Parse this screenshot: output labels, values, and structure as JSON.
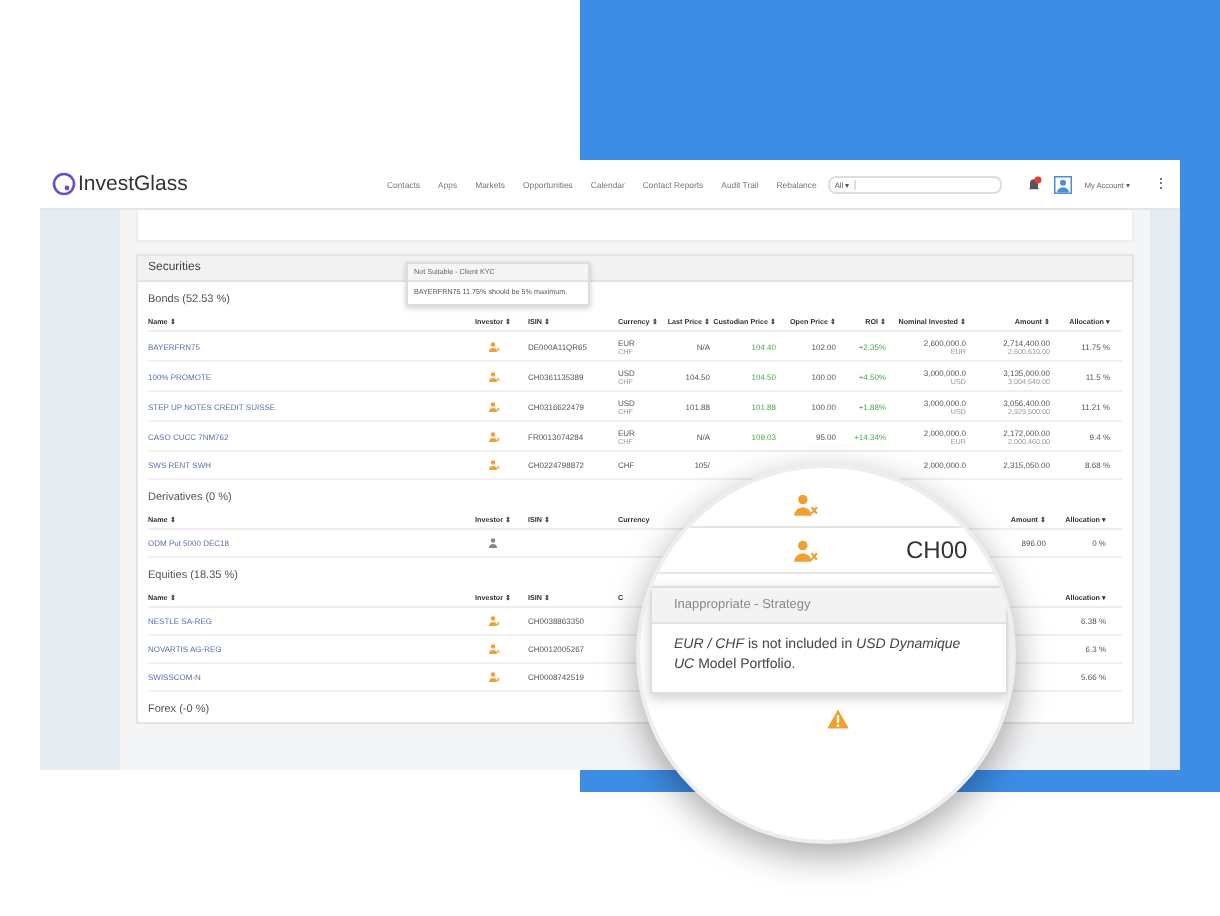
{
  "nav": {
    "logo": "InvestGlass",
    "links": [
      "Contacts",
      "Apps",
      "Markets",
      "Opportunities",
      "Calendar",
      "Contact Reports",
      "Audit Trail",
      "Rebalance"
    ],
    "search_scope": "All ▾",
    "user": "My Account ▾",
    "more": "⋮"
  },
  "securities": {
    "title": "Securities"
  },
  "sections": [
    {
      "title": "Bonds (52.53 %)",
      "columns": {
        "left": [
          "Name ⇕",
          "Investor ⇕",
          "ISIN ⇕",
          "Currency ⇕"
        ],
        "right": [
          "Last Price ⇕",
          "Custodian Price ⇕",
          "Open Price ⇕",
          "ROI ⇕",
          "Nominal Invested ⇕",
          "Amount ⇕",
          "Allocation ▾"
        ]
      },
      "rows": [
        {
          "left": [
            {
              "kind": "link",
              "text": "BAYERFRN75"
            },
            {
              "kind": "alert"
            },
            {
              "kind": "text",
              "text": "DE000A11QR65"
            },
            {
              "kind": "text",
              "text": "EUR",
              "sub": "CHF"
            }
          ],
          "right": [
            {
              "kind": "text",
              "text": "N/A"
            },
            {
              "kind": "gain",
              "text": "104.40"
            },
            {
              "kind": "text",
              "text": "102.00"
            },
            {
              "kind": "gain",
              "text": "+2.35%"
            },
            {
              "kind": "text",
              "text": "2,600,000.0",
              "sub": "EUR"
            },
            {
              "kind": "text",
              "text": "2,714,400.00",
              "sub": "2,600,610.00"
            },
            {
              "kind": "text",
              "text": "11.75 %"
            }
          ]
        },
        {
          "left": [
            {
              "kind": "link",
              "text": "100% PROMOTE"
            },
            {
              "kind": "alert"
            },
            {
              "kind": "text",
              "text": "CH0361135389"
            },
            {
              "kind": "text",
              "text": "USD",
              "sub": "CHF"
            }
          ],
          "right": [
            {
              "kind": "text",
              "text": "104.50"
            },
            {
              "kind": "gain",
              "text": "104.50"
            },
            {
              "kind": "text",
              "text": "100.00"
            },
            {
              "kind": "gain",
              "text": "+4.50%"
            },
            {
              "kind": "text",
              "text": "3,000,000.0",
              "sub": "USD"
            },
            {
              "kind": "text",
              "text": "3,135,000.00",
              "sub": "3,004,640.00"
            },
            {
              "kind": "text",
              "text": "11.5 %"
            }
          ]
        },
        {
          "left": [
            {
              "kind": "link",
              "text": "STEP UP NOTES CREDIT SUISSE"
            },
            {
              "kind": "alert"
            },
            {
              "kind": "text",
              "text": "CH0316622479"
            },
            {
              "kind": "text",
              "text": "USD",
              "sub": "CHF"
            }
          ],
          "right": [
            {
              "kind": "text",
              "text": "101.88"
            },
            {
              "kind": "gain",
              "text": "101.88"
            },
            {
              "kind": "text",
              "text": "100.00"
            },
            {
              "kind": "gain",
              "text": "+1.88%"
            },
            {
              "kind": "text",
              "text": "3,000,000.0",
              "sub": "USD"
            },
            {
              "kind": "text",
              "text": "3,056,400.00",
              "sub": "2,929,500.00"
            },
            {
              "kind": "text",
              "text": "11.21 %"
            }
          ]
        },
        {
          "left": [
            {
              "kind": "link",
              "text": "CASO CUCC 7NM762"
            },
            {
              "kind": "alert"
            },
            {
              "kind": "text",
              "text": "FR0013074284"
            },
            {
              "kind": "text",
              "text": "EUR",
              "sub": "CHF"
            }
          ],
          "right": [
            {
              "kind": "text",
              "text": "N/A"
            },
            {
              "kind": "gain",
              "text": "109.03"
            },
            {
              "kind": "text",
              "text": "95.00"
            },
            {
              "kind": "gain",
              "text": "+14.34%"
            },
            {
              "kind": "text",
              "text": "2,000,000.0",
              "sub": "EUR"
            },
            {
              "kind": "text",
              "text": "2,172,000.00",
              "sub": "2,000,460.00"
            },
            {
              "kind": "text",
              "text": "9.4 %"
            }
          ]
        },
        {
          "left": [
            {
              "kind": "link",
              "text": "SWS RENT SWH"
            },
            {
              "kind": "alert"
            },
            {
              "kind": "text",
              "text": "CH0224798872"
            },
            {
              "kind": "text",
              "text": "CHF"
            }
          ],
          "right": [
            {
              "kind": "text",
              "text": "105/"
            },
            {
              "kind": "blank"
            },
            {
              "kind": "blank"
            },
            {
              "kind": "blank"
            },
            {
              "kind": "text",
              "text": "2,000,000.0"
            },
            {
              "kind": "text",
              "text": "2,315,050.00"
            },
            {
              "kind": "text",
              "text": "8.68 %"
            }
          ]
        }
      ]
    },
    {
      "title": "Derivatives (0 %)",
      "columns": {
        "left": [
          "Name ⇕",
          "Investor ⇕",
          "ISIN ⇕",
          "Currency"
        ],
        "right": [
          "Amount ⇕",
          "Allocation ▾"
        ]
      },
      "rows": [
        {
          "left": [
            {
              "kind": "link",
              "text": "ODM Put 5000 DEC18"
            },
            {
              "kind": "person"
            }
          ],
          "right": [
            {
              "kind": "text",
              "text": "896.00"
            },
            {
              "kind": "text",
              "text": "0 %"
            }
          ]
        }
      ]
    },
    {
      "title": "Equities (18.35 %)",
      "columns": {
        "left": [
          "Name ⇕",
          "Investor ⇕",
          "ISIN ⇕",
          "C"
        ],
        "right": [
          "Allocation ▾"
        ]
      },
      "rows": [
        {
          "left": [
            {
              "kind": "link",
              "text": "NESTLE SA-REG"
            },
            {
              "kind": "alert"
            },
            {
              "kind": "text",
              "text": "CH0038863350"
            }
          ],
          "right": [
            {
              "kind": "text",
              "text": "6.38 %"
            }
          ]
        },
        {
          "left": [
            {
              "kind": "link",
              "text": "NOVARTIS AG-REG"
            },
            {
              "kind": "alert"
            },
            {
              "kind": "text",
              "text": "CH0012005267"
            }
          ],
          "right": [
            {
              "kind": "text",
              "text": "6.3 %"
            }
          ]
        },
        {
          "left": [
            {
              "kind": "link",
              "text": "SWISSCOM-N"
            },
            {
              "kind": "alert"
            },
            {
              "kind": "text",
              "text": "CH0008742519"
            }
          ],
          "right": [
            {
              "kind": "text",
              "text": "5.66 %"
            }
          ]
        }
      ]
    },
    {
      "title": "Forex (-0 %)"
    }
  ],
  "small_tooltip": {
    "title": "Not Suitable - Client KYC",
    "body": "BAYERFRN75 11.75% should be 5% maximum."
  },
  "magnifier": {
    "isin": "CH00",
    "tooltip_title": "Inappropriate - Strategy",
    "tooltip_body": "*EUR / CHF* is not included in *USD Dynamique UC* Model Portfolio."
  }
}
